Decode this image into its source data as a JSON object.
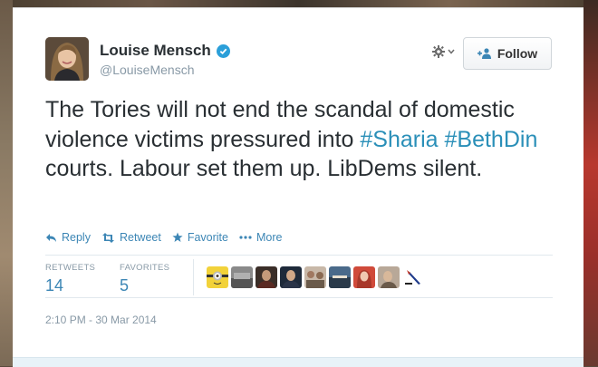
{
  "tweet": {
    "display_name": "Louise Mensch",
    "handle": "@LouiseMensch",
    "follow_label": "Follow",
    "text": {
      "part1": "The Tories will not end the scandal of domestic violence victims pressured into ",
      "hashtag1": "#Sharia",
      "space": " ",
      "hashtag2": "#BethDin",
      "part2": " courts. Labour set them up. LibDems silent."
    },
    "actions": {
      "reply": "Reply",
      "retweet": "Retweet",
      "favorite": "Favorite",
      "more": "More"
    },
    "stats": {
      "retweets_label": "RETWEETS",
      "retweets_count": "14",
      "favorites_label": "FAVORITES",
      "favorites_count": "5"
    },
    "timestamp": "2:10 PM - 30 Mar 2014"
  },
  "colors": {
    "link": "#3c86b5",
    "hashtag": "#2a8fb8",
    "verified": "#2b9fd9",
    "text": "#292f33",
    "muted": "#8899a6"
  }
}
